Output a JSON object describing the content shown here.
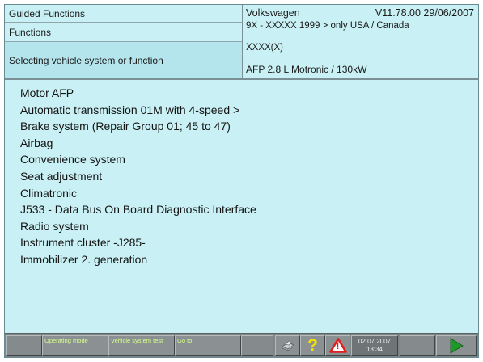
{
  "header": {
    "left": {
      "row1": "Guided Functions",
      "row2": "Functions",
      "row3": "Selecting vehicle system or function"
    },
    "right": {
      "make": "Volkswagen",
      "version": "V11.78.00 29/06/2007",
      "model_line": "9X - XXXXX 1999 > only USA / Canada",
      "model_code": "XXXX(X)",
      "engine": "AFP 2.8 L Motronic / 130kW"
    }
  },
  "functions": [
    "Motor AFP",
    "Automatic transmission 01M with 4-speed >",
    "Brake system (Repair Group 01; 45 to 47)",
    "Airbag",
    "Convenience system",
    "Seat adjustment",
    "Climatronic",
    "J533 - Data Bus On Board Diagnostic Interface",
    "Radio system",
    "Instrument cluster -J285-",
    "Immobilizer 2. generation"
  ],
  "toolbar": {
    "btn_operating_mode": "Operating mode",
    "btn_vehicle_system_test": "Vehicle system test",
    "btn_go_to": "Go to",
    "help_symbol": "?",
    "warning_symbol": "!",
    "date": "02.07.2007",
    "time": "13:34"
  },
  "icons": {
    "print": "printer-icon",
    "help": "help-icon",
    "warning": "warning-icon",
    "next": "next-arrow-icon"
  },
  "colors": {
    "background": "#c9f0f4",
    "selected_row": "#b4e4ec",
    "toolbar": "#7f8587",
    "toolbar_label": "#d8ff8c",
    "help": "#f5e100",
    "warning": "#e02020",
    "next": "#1e9a2a"
  }
}
